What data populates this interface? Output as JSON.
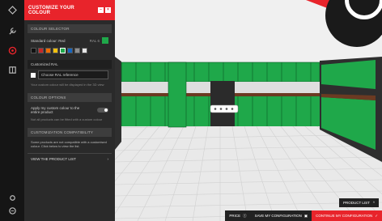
{
  "panel": {
    "title": "CUSTOMIZE YOUR COLOUR",
    "colour_selector": {
      "heading": "COLOUR SELECTOR",
      "label": "Standard colour: Red",
      "code": "RAL 6",
      "swatches": [
        "#111111",
        "#c62828",
        "#ef6c00",
        "#f4c20d",
        "#1fa84a",
        "#1565c0",
        "#8e8e8e",
        "#e8e8e8"
      ],
      "selected_index": 4
    },
    "custom_ral": {
      "label": "Customized RAL",
      "placeholder": "Choose RAL reference",
      "note": "Your custom colour will be displayed in the 3D view"
    },
    "colour_options": {
      "heading": "COLOUR OPTIONS",
      "apply_text": "Apply my custom colour to the entire product",
      "apply_note": "Not all products can be fitted with a custom colour"
    },
    "compat": {
      "heading": "CUSTOMIZATION COMPATIBILITY",
      "text": "Some products are not compatible with a customised colour. Click below to view the list.",
      "link": "VIEW THE PRODUCT LIST"
    }
  },
  "viewport": {
    "product_list_label": "PRODUCT LIST",
    "bottom": {
      "price": "PRICE",
      "save": "SAVE MY CONFIGURATION",
      "order": "CONTINUE MY CONFIGURATION"
    }
  },
  "colors": {
    "accent": "#e8242b",
    "cabinet_green": "#1fa84a"
  }
}
